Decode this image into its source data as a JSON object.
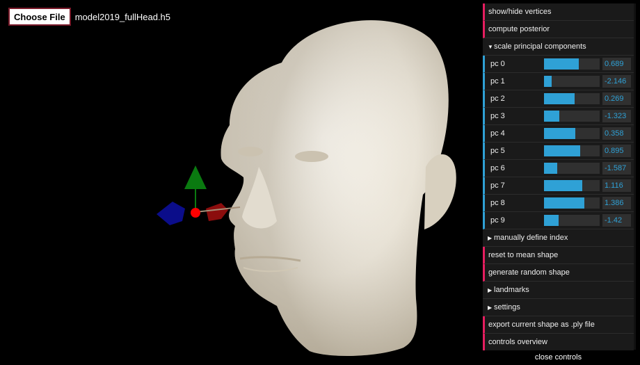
{
  "file": {
    "button_label": "Choose File",
    "file_name": "model2019_fullHead.h5"
  },
  "gui": {
    "show_hide_vertices": "show/hide vertices",
    "compute_posterior": "compute posterior",
    "scale_folder": "scale principal components",
    "pcs": [
      {
        "label": "pc 0",
        "value": "0.689",
        "fill": 0.62
      },
      {
        "label": "pc 1",
        "value": "-2.146",
        "fill": 0.14
      },
      {
        "label": "pc 2",
        "value": "0.269",
        "fill": 0.55
      },
      {
        "label": "pc 3",
        "value": "-1.323",
        "fill": 0.27
      },
      {
        "label": "pc 4",
        "value": "0.358",
        "fill": 0.56
      },
      {
        "label": "pc 5",
        "value": "0.895",
        "fill": 0.65
      },
      {
        "label": "pc 6",
        "value": "-1.587",
        "fill": 0.24
      },
      {
        "label": "pc 7",
        "value": "1.116",
        "fill": 0.69
      },
      {
        "label": "pc 8",
        "value": "1.386",
        "fill": 0.73
      },
      {
        "label": "pc 9",
        "value": "-1.42",
        "fill": 0.26
      }
    ],
    "manual_index_folder": "manually define index",
    "reset_mean": "reset to mean shape",
    "random_shape": "generate random shape",
    "landmarks_folder": "landmarks",
    "settings_folder": "settings",
    "export_ply": "export current shape as .ply file",
    "controls_overview": "controls overview",
    "close_controls": "close controls"
  },
  "colors": {
    "button_accent": "#e61d5f",
    "number_accent": "#2fa1d6",
    "gizmo_x": "#8b0d0d",
    "gizmo_y": "#0a7a10",
    "gizmo_z": "#0b0d8a",
    "skin": "#e8e2d6"
  }
}
